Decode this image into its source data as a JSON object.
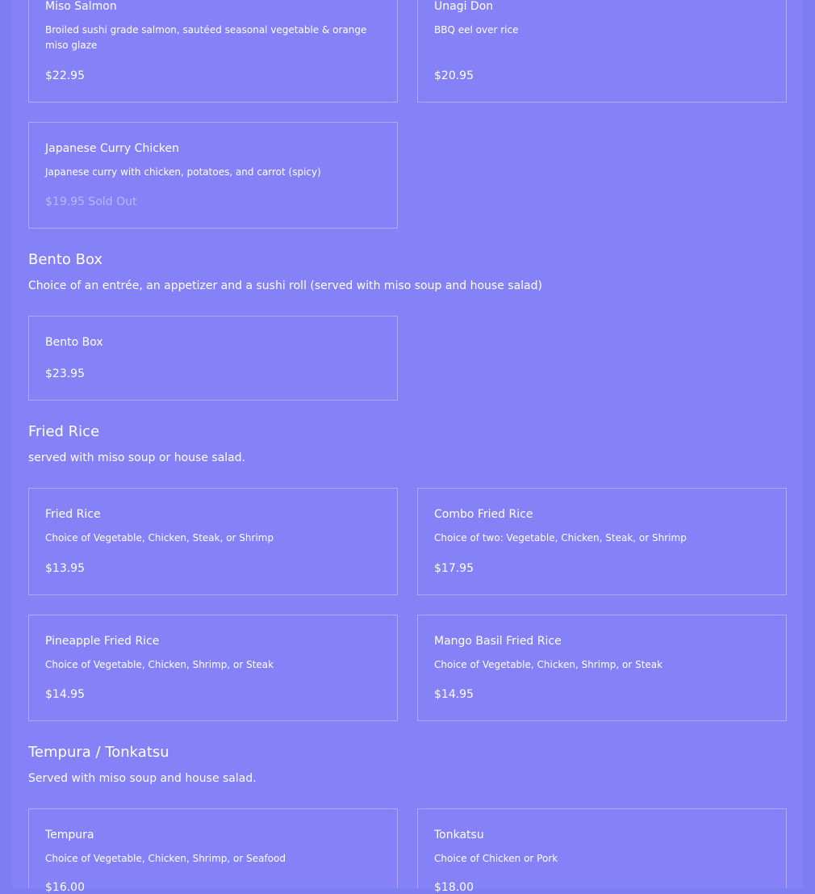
{
  "cards": {
    "miso_salmon": {
      "name": "Miso Salmon",
      "desc": "Broiled sushi grade salmon, sautéed seasonal vegetable & orange miso glaze",
      "price": "$22.95"
    },
    "unagi_don": {
      "name": "Unagi Don",
      "desc": "BBQ eel over rice",
      "price": "$20.95"
    },
    "curry_chicken": {
      "name": "Japanese Curry Chicken",
      "desc": "Japanese curry with chicken, potatoes, and carrot (spicy)",
      "price": "$19.95 Sold Out"
    },
    "bento_box": {
      "name": "Bento Box",
      "price": "$23.95"
    },
    "fried_rice": {
      "name": "Fried Rice",
      "desc": "Choice of Vegetable, Chicken, Steak, or Shrimp",
      "price": "$13.95"
    },
    "combo_fried_rice": {
      "name": "Combo Fried Rice",
      "desc": "Choice of two: Vegetable, Chicken, Steak, or Shrimp",
      "price": "$17.95"
    },
    "pineapple_fried_rice": {
      "name": "Pineapple Fried Rice",
      "desc": "Choice of Vegetable, Chicken, Shrimp, or Steak",
      "price": "$14.95"
    },
    "mango_basil_fried_rice": {
      "name": "Mango Basil Fried Rice",
      "desc": "Choice of Vegetable, Chicken, Shrimp, or Steak",
      "price": "$14.95"
    },
    "tempura": {
      "name": "Tempura",
      "desc": "Choice of Vegetable, Chicken, Shrimp, or Seafood",
      "price": "$16.00"
    },
    "tonkatsu": {
      "name": "Tonkatsu",
      "desc": "Choice of Chicken or Pork",
      "price": "$18.00"
    }
  },
  "sections": {
    "bento": {
      "title": "Bento Box",
      "desc": "Choice of an entrée, an appetizer and a sushi roll (served with miso soup and house salad)"
    },
    "fried_rice": {
      "title": "Fried Rice",
      "desc": "served with miso soup or house salad."
    },
    "tempura": {
      "title": "Tempura / Tonkatsu",
      "desc": "Served with miso soup and house salad."
    }
  },
  "colors": {
    "background": "#7c7ef2",
    "panel": "#8482f6",
    "border": "#ababf8",
    "text": "#ffffff",
    "sold_out_text": "#b9b8fb"
  }
}
